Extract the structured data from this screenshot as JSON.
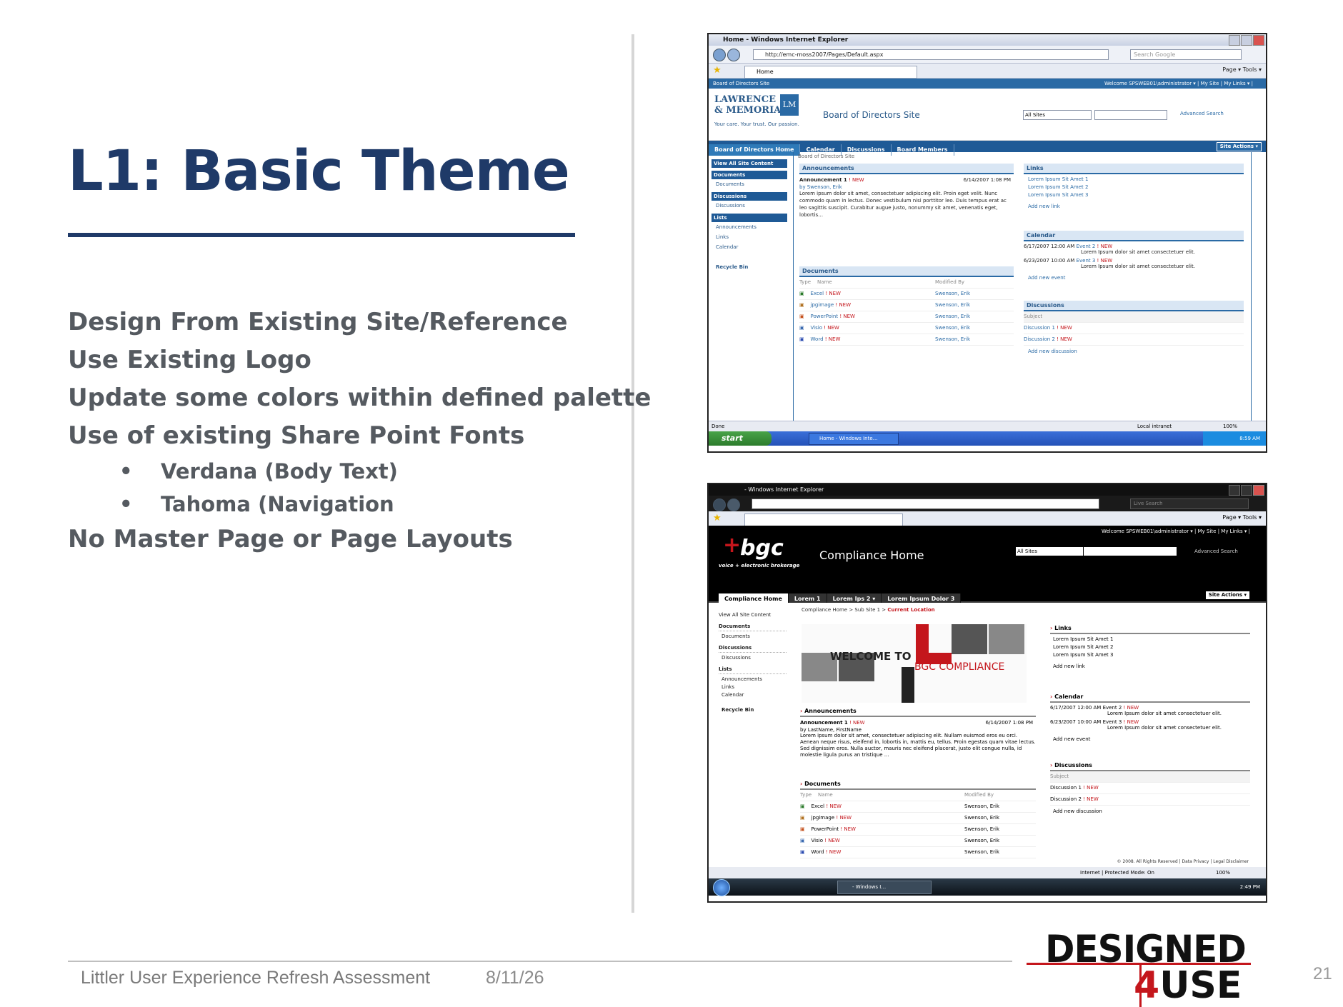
{
  "slide": {
    "title": "L1: Basic Theme",
    "bullets": [
      "Design From Existing Site/Reference",
      "Use Existing Logo",
      "Update some colors within defined palette",
      "Use of existing Share Point Fonts"
    ],
    "sub_bullets": [
      "Verdana (Body Text)",
      "Tahoma (Navigation"
    ],
    "last_bullet": "No Master Page or Page Layouts",
    "bullet_glyph": "•",
    "footer_text": "Littler User Experience Refresh Assessment",
    "footer_date": "8/11/26",
    "page_number": "21",
    "logo": {
      "line1": "DESIGNED",
      "line2_red": "4",
      "line2": "USE"
    },
    "colors": {
      "title": "#1f3a68",
      "body": "#555a60",
      "accent_red": "#c4161c"
    }
  },
  "shot1": {
    "window_title": "Home - Windows Internet Explorer",
    "url": "http://emc-moss2007/Pages/Default.aspx",
    "search_placeholder": "Search Google",
    "tab": "Home",
    "tools": "Page ▾  Tools ▾",
    "site_breadcrumb": "Board of Directors Site",
    "welcome": "Welcome SPSWEB01\\administrator ▾  |  My Site  |  My Links ▾  |",
    "logo_line1": "LAWRENCE",
    "logo_line2": "& MEMORIAL",
    "logo_mark": "LM",
    "tagline": "Your care. Your trust. Our passion.",
    "site_title": "Board of Directors Site",
    "scope": "All Sites",
    "advanced": "Advanced Search",
    "tabs": [
      "Board of Directors Home",
      "Calendar",
      "Discussions",
      "Board Members"
    ],
    "site_actions": "Site Actions ▾",
    "quicklaunch": {
      "view_all": "View All Site Content",
      "documents": "Documents",
      "documents_item": "Documents",
      "discussions": "Discussions",
      "discussions_item": "Discussions",
      "lists": "Lists",
      "list_items": [
        "Announcements",
        "Links",
        "Calendar"
      ],
      "recycle": "Recycle Bin"
    },
    "breadcrumb": "Board of Directors Site",
    "announcements": {
      "title": "Announcements",
      "item": "Announcement 1",
      "date": "6/14/2007 1:08 PM",
      "by": "by Swenson, Erik",
      "body": "Lorem ipsum dolor sit amet, consectetuer adipiscing elit. Proin eget velit. Nunc commodo quam in lectus. Donec vestibulum nisi porttitor leo. Duis tempus erat ac leo sagittis suscipit. Curabitur augue justo, nonummy sit amet, venenatis eget, lobortis…"
    },
    "documents": {
      "title": "Documents",
      "col_type": "Type",
      "col_name": "Name",
      "col_mod": "Modified By",
      "rows": [
        {
          "name": "Excel",
          "by": "Swenson, Erik"
        },
        {
          "name": "jpgimage",
          "by": "Swenson, Erik"
        },
        {
          "name": "PowerPoint",
          "by": "Swenson, Erik"
        },
        {
          "name": "Visio",
          "by": "Swenson, Erik"
        },
        {
          "name": "Word",
          "by": "Swenson, Erik"
        }
      ]
    },
    "links": {
      "title": "Links",
      "items": [
        "Lorem Ipsum Sit Amet 1",
        "Lorem Ipsum Sit Amet 2",
        "Lorem Ipsum Sit Amet 3"
      ],
      "add": "Add new link"
    },
    "calendar": {
      "title": "Calendar",
      "events": [
        {
          "when": "6/17/2007 12:00 AM",
          "name": "Event 2",
          "desc": "Lorem Ipsum dolor sit amet consectetuer elit."
        },
        {
          "when": "6/23/2007 10:00 AM",
          "name": "Event 3",
          "desc": "Lorem Ipsum dolor sit amet consectetuer elit."
        }
      ],
      "add": "Add new event"
    },
    "discussions": {
      "title": "Discussions",
      "subject": "Subject",
      "items": [
        "Discussion 1",
        "Discussion 2"
      ],
      "add": "Add new discussion"
    },
    "new_tag": "! NEW",
    "status": "Done",
    "zone": "Local intranet",
    "zoom": "100%",
    "start": "start",
    "task_button": "Home - Windows Inte…",
    "clock": "8:59 AM"
  },
  "shot2": {
    "window_title": "- Windows Internet Explorer",
    "search_placeholder": "Live Search",
    "tools": "Page ▾  Tools ▾",
    "welcome": "Welcome SPSWEB01\\administrator ▾  |  My Site  |  My Links ▾  |",
    "logo": "bgc",
    "tagline": "voice + electronic brokerage",
    "title": "Compliance Home",
    "scope": "All Sites",
    "advanced": "Advanced Search",
    "tabs": [
      "Compliance Home",
      "Lorem 1",
      "Lorem Ips 2 ▾",
      "Lorem Ipsum Dolor 3"
    ],
    "site_actions": "Site Actions ▾",
    "breadcrumb_a": "Compliance Home  >  Sub Site 1  >",
    "breadcrumb_current": "Current Location",
    "quicklaunch": {
      "view_all": "View All Site Content",
      "documents": "Documents",
      "documents_item": "Documents",
      "discussions": "Discussions",
      "discussions_item": "Discussions",
      "lists": "Lists",
      "list_items": [
        "Announcements",
        "Links",
        "Calendar"
      ],
      "recycle": "Recycle Bin"
    },
    "welcome_banner_1": "WELCOME TO",
    "welcome_banner_2": "BGC COMPLIANCE",
    "announcements": {
      "title": "Announcements",
      "item": "Announcement 1",
      "date": "6/14/2007 1:08 PM",
      "by": "by LastName, FirstName",
      "body": "Lorem ipsum dolor sit amet, consectetuer adipiscing elit. Nullam euismod eros eu orci. Aenean neque risus, eleifend in, lobortis in, mattis eu, tellus. Proin egestas quam vitae lectus. Sed dignissim eros. Nulla auctor, mauris nec eleifend placerat, justo elit congue nulla, id molestie ligula purus an tristique …"
    },
    "documents": {
      "title": "Documents",
      "col_type": "Type",
      "col_name": "Name",
      "col_mod": "Modified By",
      "rows": [
        {
          "name": "Excel",
          "by": "Swenson, Erik"
        },
        {
          "name": "jpgimage",
          "by": "Swenson, Erik"
        },
        {
          "name": "PowerPoint",
          "by": "Swenson, Erik"
        },
        {
          "name": "Visio",
          "by": "Swenson, Erik"
        },
        {
          "name": "Word",
          "by": "Swenson, Erik"
        }
      ]
    },
    "links": {
      "title": "Links",
      "items": [
        "Lorem Ipsum Sit Amet 1",
        "Lorem Ipsum Sit Amet 2",
        "Lorem Ipsum Sit Amet 3"
      ],
      "add": "Add new link"
    },
    "calendar": {
      "title": "Calendar",
      "events": [
        {
          "when": "6/17/2007 12:00 AM",
          "name": "Event 2",
          "desc": "Lorem Ipsum dolor sit amet consectetuer elit."
        },
        {
          "when": "6/23/2007 10:00 AM",
          "name": "Event 3",
          "desc": "Lorem Ipsum dolor sit amet consectetuer elit."
        }
      ],
      "add": "Add new event"
    },
    "discussions": {
      "title": "Discussions",
      "subject": "Subject",
      "items": [
        "Discussion 1",
        "Discussion 2"
      ],
      "add": "Add new discussion"
    },
    "new_tag": "! NEW",
    "copyright": "© 2008. All Rights Reserved  |  Data Privacy  |  Legal Disclaimer",
    "zone": "Internet | Protected Mode: On",
    "zoom": "100%",
    "task_button": "- Windows I…",
    "clock": "2:49 PM"
  }
}
